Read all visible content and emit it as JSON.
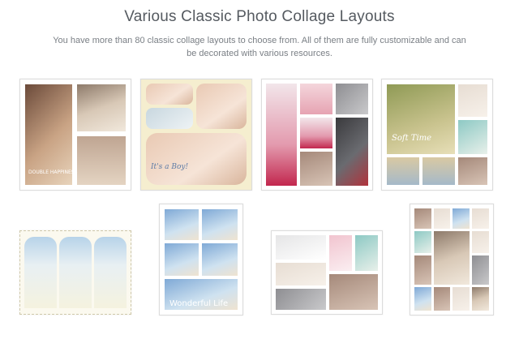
{
  "header": {
    "title": "Various Classic Photo Collage Layouts",
    "subtitle": "You have more than 80 classic collage layouts to choose from. All of them are fully customizable and can be decorated with various resources."
  },
  "overlays": {
    "wedding_caption": "DOUBLE HAPPINESS",
    "its_a_boy": "It's a Boy!",
    "soft_time": "Soft Time",
    "wonderful_life": "Wonderful Life"
  }
}
